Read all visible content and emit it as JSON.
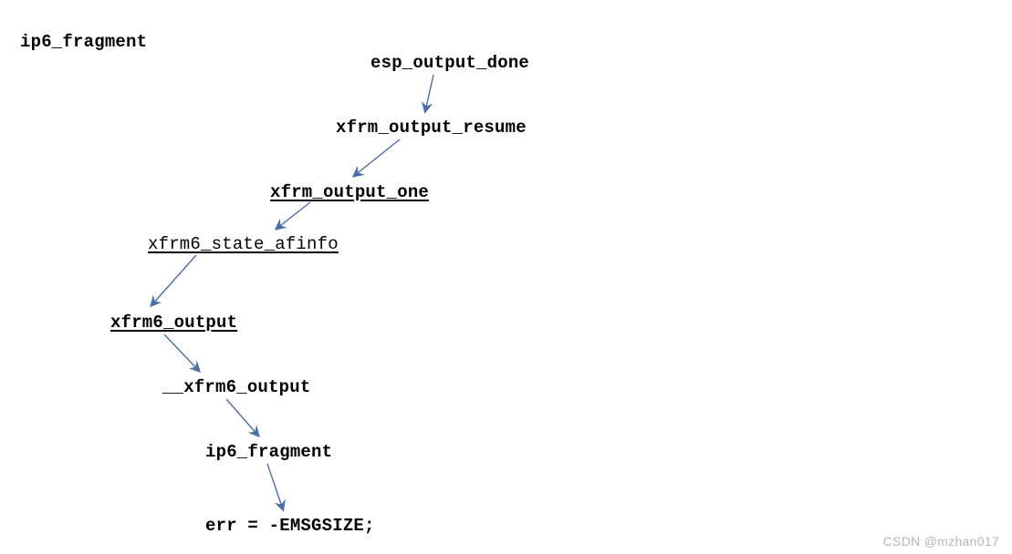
{
  "title": "ip6_fragment",
  "nodes": {
    "esp_output_done": {
      "label": "esp_output_done"
    },
    "xfrm_output_resume": {
      "label": "xfrm_output_resume"
    },
    "xfrm_output_one": {
      "label": "xfrm_output_one"
    },
    "xfrm6_state_afinfo": {
      "label": "xfrm6_state_afinfo"
    },
    "xfrm6_output": {
      "label": "xfrm6_output"
    },
    "dunder_xfrm6_output": {
      "label": "__xfrm6_output"
    },
    "ip6_fragment": {
      "label": "ip6_fragment"
    },
    "err_line": {
      "label": "err = -EMSGSIZE;"
    }
  },
  "watermark": "CSDN @mzhan017"
}
